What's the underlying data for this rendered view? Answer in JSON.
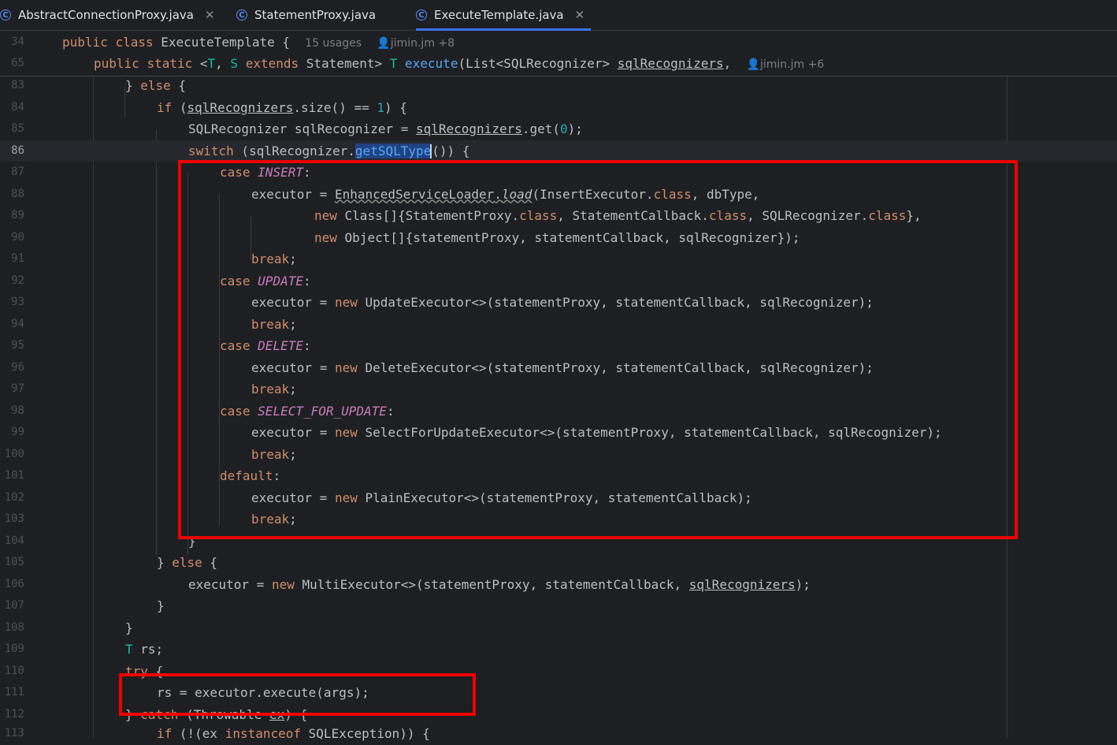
{
  "tabs": [
    {
      "label": "AbstractConnectionProxy.java",
      "closable": true
    },
    {
      "label": "StatementProxy.java",
      "closable": false
    },
    {
      "label": "ExecuteTemplate.java",
      "closable": true,
      "active": true
    }
  ],
  "tab_icon_glyph": "C",
  "sticky": {
    "line34": {
      "num": "34",
      "kw1": "public",
      "kw2": "class",
      "name": "ExecuteTemplate",
      "brace": " {",
      "usages": "15 usages",
      "author": "jimin.jm +8"
    },
    "line65": {
      "num": "65",
      "kw1": "public",
      "kw2": "static",
      "lt": "<",
      "T": "T",
      "comma": ", ",
      "S": "S",
      "ext": "extends",
      "stmt": " Statement> ",
      "T2": "T",
      "fn": "execute",
      "params": "(List<SQLRecognizer> ",
      "param": "sqlRecognizers",
      "trail": ",",
      "author": "jimin.jm +6"
    }
  },
  "lines": {
    "l83": {
      "num": "83",
      "a": "} ",
      "b": "else",
      "c": " {"
    },
    "l84": {
      "num": "84",
      "a": "if",
      "b": " (",
      "c": "sqlRecognizers",
      "d": ".size() == ",
      "e": "1",
      "f": ") {"
    },
    "l85": {
      "num": "85",
      "a": "SQLRecognizer sqlRecognizer = ",
      "b": "sqlRecognizers",
      "c": ".get(",
      "d": "0",
      "e": ");"
    },
    "l86": {
      "num": "86",
      "a": "switch",
      "b": " (sqlRecognizer.",
      "c": "getSQLType",
      "d": "()) {"
    },
    "l87": {
      "num": "87",
      "a": "case",
      "b": "INSERT",
      "c": ":"
    },
    "l88": {
      "num": "88",
      "a": "executor = ",
      "b": "EnhancedServiceLoader",
      "c": ".",
      "d": "load",
      "e": "(InsertExecutor.",
      "f": "class",
      "g": ", dbType,"
    },
    "l89": {
      "num": "89",
      "a": "new",
      "b": " Class[]{StatementProxy.",
      "c": "class",
      "d": ", StatementCallback.",
      "e": "class",
      "f": ", SQLRecognizer.",
      "g": "class",
      "h": "},"
    },
    "l90": {
      "num": "90",
      "a": "new",
      "b": " Object[]{statementProxy, statementCallback, sqlRecognizer});"
    },
    "l91": {
      "num": "91",
      "a": "break",
      "b": ";"
    },
    "l92": {
      "num": "92",
      "a": "case",
      "b": "UPDATE",
      "c": ":"
    },
    "l93": {
      "num": "93",
      "a": "executor = ",
      "b": "new",
      "c": " UpdateExecutor<>(statementProxy, statementCallback, sqlRecognizer);"
    },
    "l94": {
      "num": "94",
      "a": "break",
      "b": ";"
    },
    "l95": {
      "num": "95",
      "a": "case",
      "b": "DELETE",
      "c": ":"
    },
    "l96": {
      "num": "96",
      "a": "executor = ",
      "b": "new",
      "c": " DeleteExecutor<>(statementProxy, statementCallback, sqlRecognizer);"
    },
    "l97": {
      "num": "97",
      "a": "break",
      "b": ";"
    },
    "l98": {
      "num": "98",
      "a": "case",
      "b": "SELECT_FOR_UPDATE",
      "c": ":"
    },
    "l99": {
      "num": "99",
      "a": "executor = ",
      "b": "new",
      "c": " SelectForUpdateExecutor<>(statementProxy, statementCallback, sqlRecognizer);"
    },
    "l100": {
      "num": "100",
      "a": "break",
      "b": ";"
    },
    "l101": {
      "num": "101",
      "a": "default",
      "b": ":"
    },
    "l102": {
      "num": "102",
      "a": "executor = ",
      "b": "new",
      "c": " PlainExecutor<>(statementProxy, statementCallback);"
    },
    "l103": {
      "num": "103",
      "a": "break",
      "b": ";"
    },
    "l104": {
      "num": "104",
      "a": "}"
    },
    "l105": {
      "num": "105",
      "a": "} ",
      "b": "else",
      "c": " {"
    },
    "l106": {
      "num": "106",
      "a": "executor = ",
      "b": "new",
      "c": " MultiExecutor<>(statementProxy, statementCallback, ",
      "d": "sqlRecognizers",
      "e": ");"
    },
    "l107": {
      "num": "107",
      "a": "}"
    },
    "l108": {
      "num": "108",
      "a": "}"
    },
    "l109": {
      "num": "109",
      "a": "T",
      "b": " rs;"
    },
    "l110": {
      "num": "110",
      "a": "try",
      "b": " {"
    },
    "l111": {
      "num": "111",
      "a": "rs = executor.execute(args);"
    },
    "l112": {
      "num": "112",
      "a": "} ",
      "b": "catch",
      "c": " (Throwable ",
      "d": "ex",
      "e": ") {"
    },
    "l113": {
      "num": "113",
      "a": "if",
      "b": " (!(",
      "c": "ex",
      "d": " ",
      "e": "instanceof",
      "f": " SQLException)) {"
    }
  },
  "colors": {
    "background": "#1e1f22",
    "keyword": "#cf8e6d",
    "function": "#56a8f5",
    "number": "#2aacb8",
    "constant": "#c77dbb",
    "annotation_box": "#ee0000"
  }
}
